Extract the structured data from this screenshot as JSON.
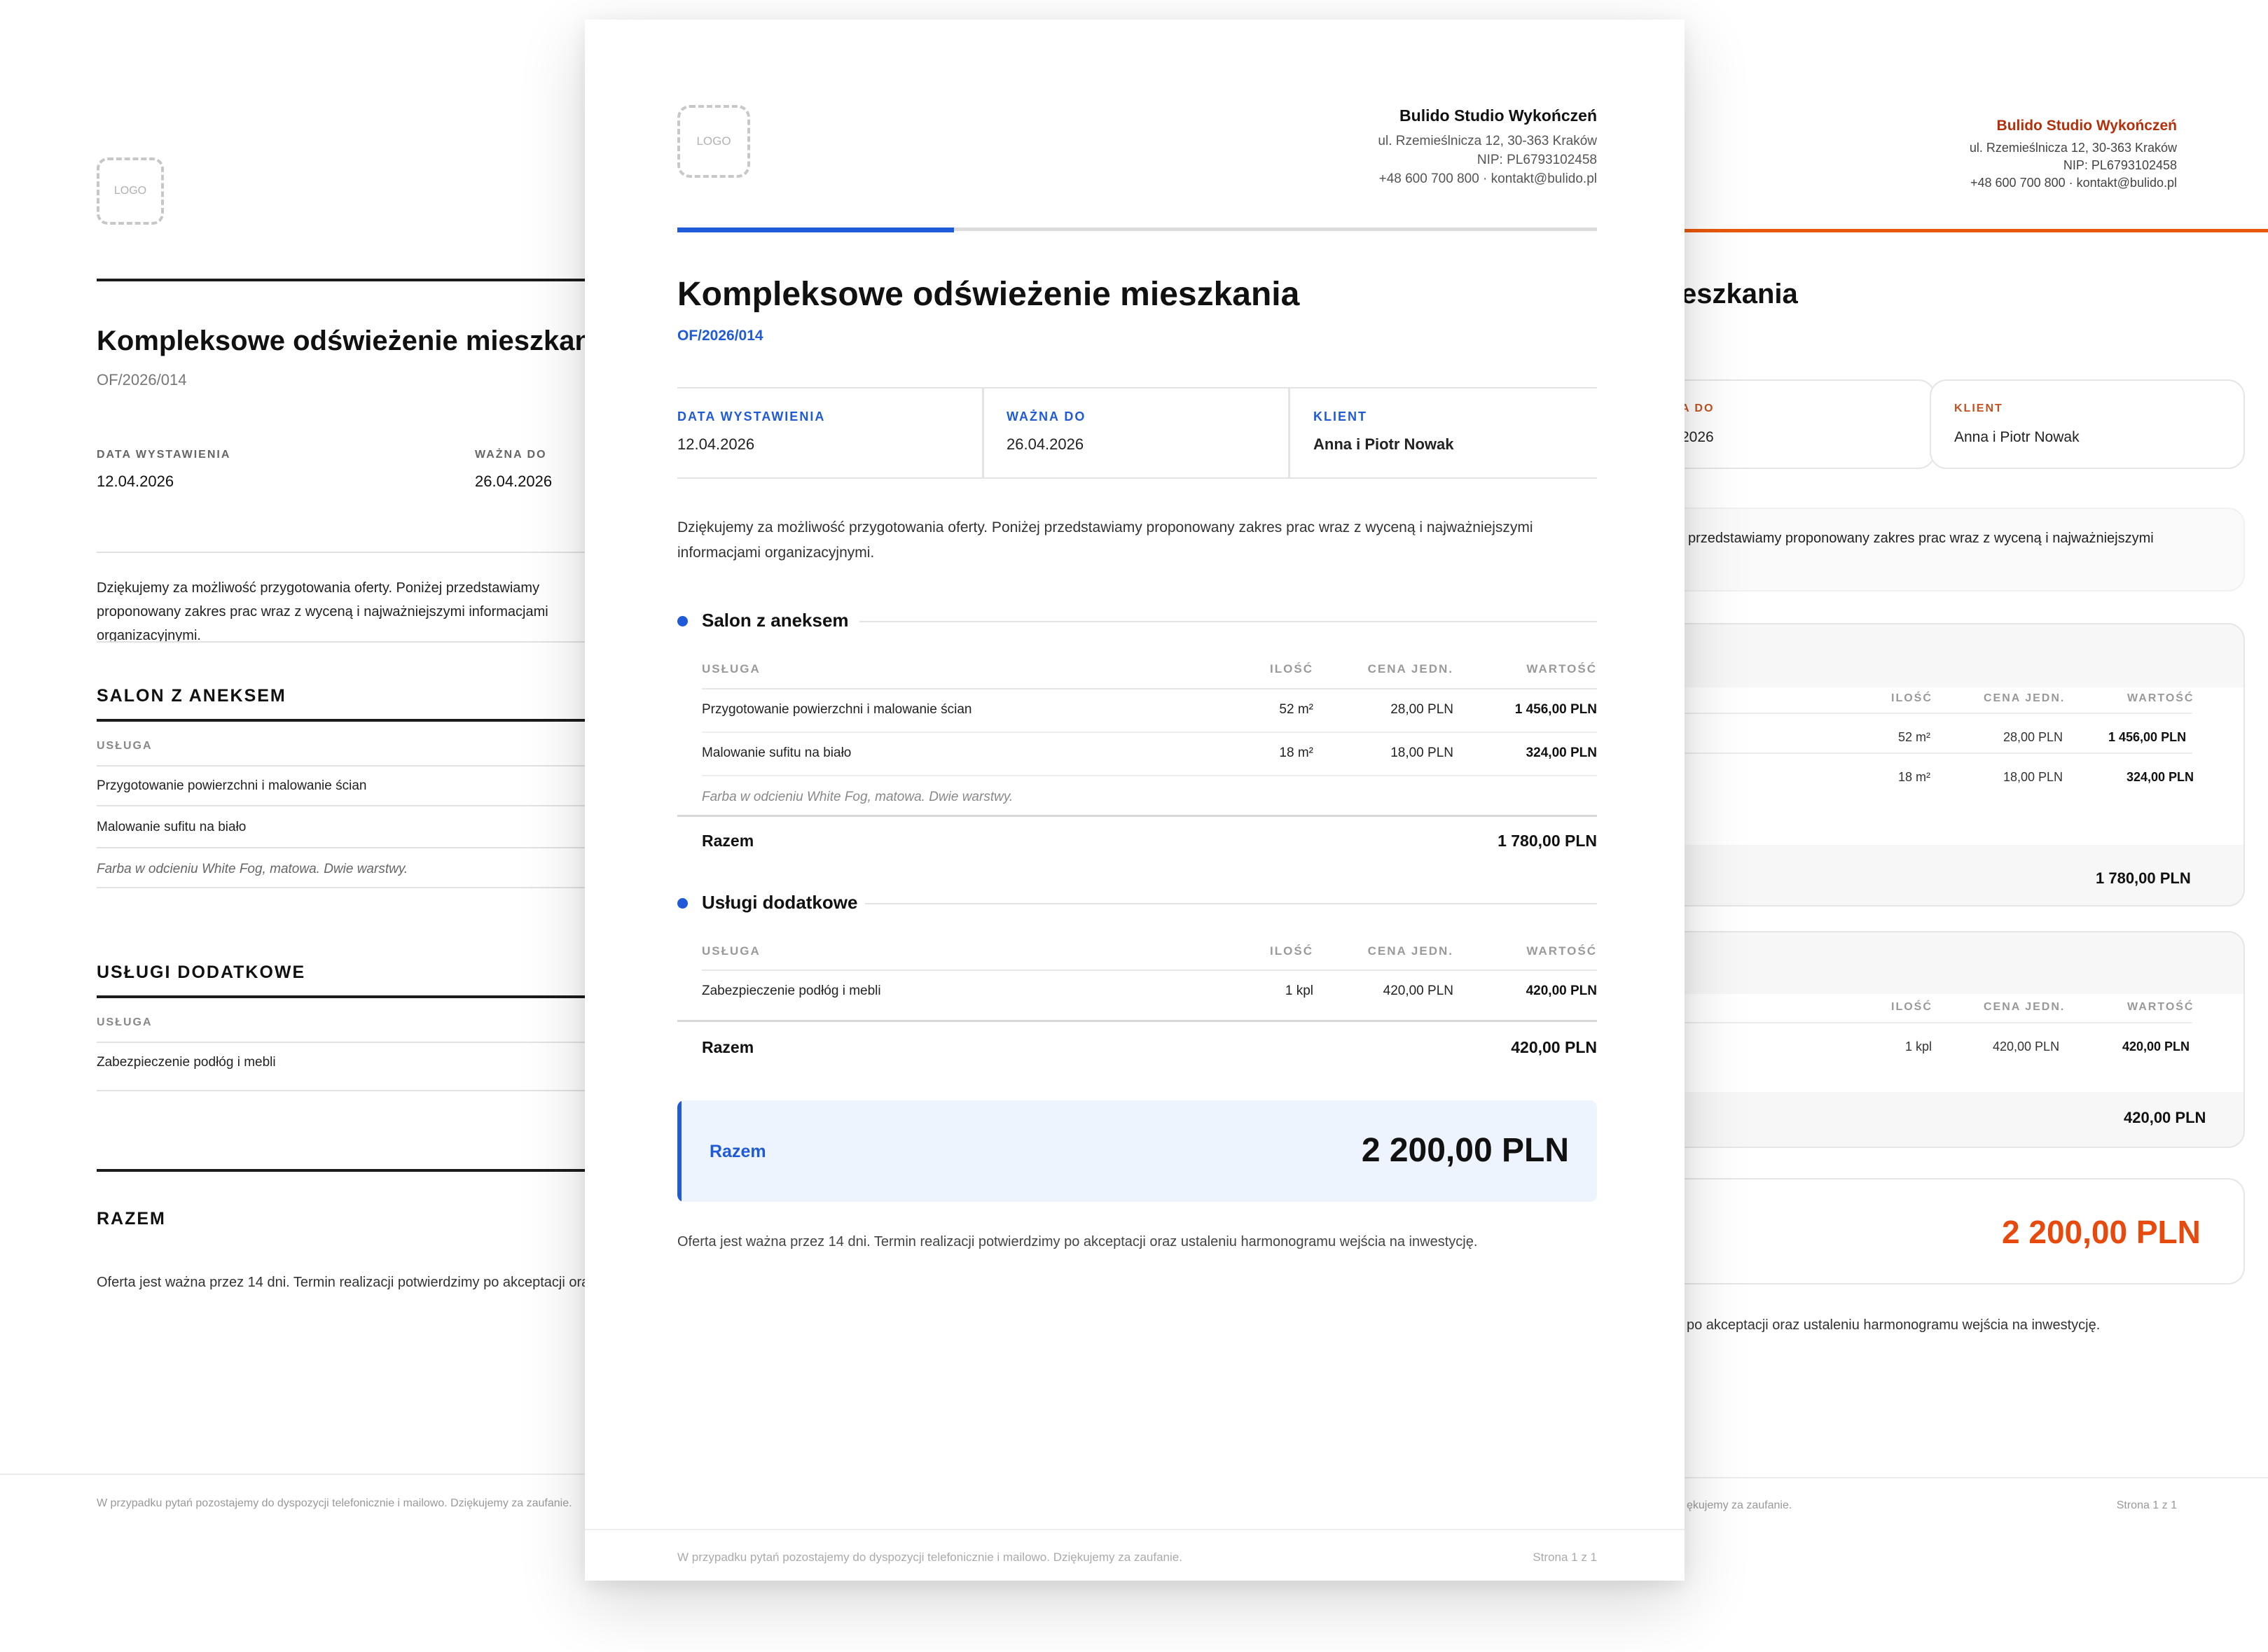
{
  "company": {
    "name": "Bulido Studio Wykończeń",
    "address": "ul. Rzemieślnicza 12, 30-363 Kraków",
    "nip": "NIP: PL6793102458",
    "contact": "+48 600 700 800 · kontakt@bulido.pl"
  },
  "logo_placeholder": "LOGO",
  "offer": {
    "title": "Kompleksowe odświeżenie mieszkania",
    "number": "OF/2026/014",
    "intro": "Dziękujemy za możliwość przygotowania oferty. Poniżej przedstawiamy proponowany zakres prac wraz z wyceną i najważniejszymi informacjami organizacyjnymi."
  },
  "meta": {
    "issue_label": "DATA WYSTAWIENIA",
    "issue_date": "12.04.2026",
    "valid_label": "WAŻNA DO",
    "valid_date": "26.04.2026",
    "client_label": "KLIENT",
    "client_name": "Anna i Piotr Nowak"
  },
  "table_headers": {
    "service": "USŁUGA",
    "qty": "ILOŚĆ",
    "unit_price": "CENA JEDN.",
    "value": "WARTOŚĆ"
  },
  "sections": [
    {
      "title": "Salon z aneksem",
      "title_upper": "SALON Z ANEKSEM",
      "rows": [
        {
          "service": "Przygotowanie powierzchni i malowanie ścian",
          "qty": "52 m²",
          "unit_price": "28,00 PLN",
          "value": "1 456,00 PLN"
        },
        {
          "service": "Malowanie sufitu na biało",
          "qty": "18 m²",
          "unit_price": "18,00 PLN",
          "value": "324,00 PLN"
        }
      ],
      "note": "Farba w odcieniu White Fog, matowa. Dwie warstwy.",
      "sum_label": "Razem",
      "sum_value": "1 780,00 PLN"
    },
    {
      "title": "Usługi dodatkowe",
      "title_upper": "USŁUGI DODATKOWE",
      "rows": [
        {
          "service": "Zabezpieczenie podłóg i mebli",
          "qty": "1 kpl",
          "unit_price": "420,00 PLN",
          "value": "420,00 PLN"
        }
      ],
      "sum_label": "Razem",
      "sum_value": "420,00 PLN"
    }
  ],
  "total": {
    "label": "Razem",
    "label_upper": "RAZEM",
    "value": "2 200,00 PLN"
  },
  "validity_text": "Oferta jest ważna przez 14 dni. Termin realizacji potwierdzimy po akceptacji oraz ustaleniu harmonogramu wejścia na inwestycję.",
  "footer": {
    "text": "W przypadku pytań pozostajemy do dyspozycji telefonicznie i mailowo. Dziękujemy za zaufanie.",
    "page": "Strona 1 z 1"
  },
  "right_partial": {
    "title": "eszkania",
    "valid_label": "A DO",
    "valid_date": "2026",
    "intro_line1": "j przedstawiamy proponowany zakres prac wraz z wyceną i najważniejszymi",
    "validity": "po akceptacji oraz ustaleniu harmonogramu wejścia na inwestycję.",
    "footer": "ękujemy za zaufanie."
  },
  "colors": {
    "blue_accent": "#1f5ad8",
    "orange_accent": "#e8590c",
    "dark": "#1b1b1b"
  }
}
